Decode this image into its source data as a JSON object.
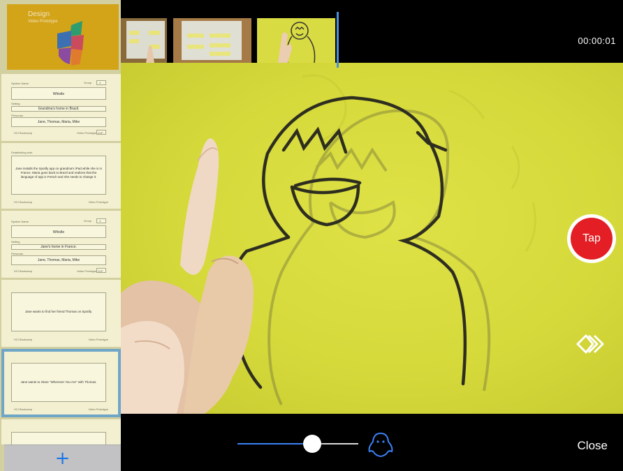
{
  "timecode": "00:00:01",
  "controls": {
    "tap_label": "Tap",
    "close_label": "Close",
    "add_label": "+",
    "opacity_slider_value": 0.62
  },
  "sidebar": {
    "cover": {
      "title": "Design",
      "subtitle": "Video Prototype"
    },
    "cards": [
      {
        "system_name_label": "System Name",
        "group_label": "Group",
        "group_value": "4",
        "system_name": "Whistle",
        "setting_label": "Setting",
        "setting": "Grandma's home in Brazil.",
        "personas_label": "Personas",
        "personas": "Jane, Thomas, Maria, Mike",
        "footer_left": "HCI Bootcamp",
        "footer_right": "Video Prototype",
        "footer_badge": "2VP"
      },
      {
        "header": "Establishing shot",
        "text": "Jane installs the Spotify app on grandma's iPad while she is in France. Maria goes back to Brazil and realizes that the language of app is French and she needs to change it.",
        "footer_left": "HCI Bootcamp",
        "footer_right": "Video Prototype"
      },
      {
        "system_name_label": "System Name",
        "group_label": "Group",
        "group_value": "4",
        "system_name": "Whistle",
        "setting_label": "Setting",
        "setting": "Jane's home in France.",
        "personas_label": "Personas",
        "personas": "Jane, Thomas, Maria, Mike",
        "footer_left": "HCI Bootcamp",
        "footer_right": "Video Prototype",
        "footer_badge": "2VP"
      },
      {
        "text": "Jane wants to find her friend Thomas on Spotify.",
        "footer_left": "HCI Bootcamp",
        "footer_right": "Video Prototype"
      },
      {
        "text": "Jane wants to share \"Wherever You Are\" with Thomas.",
        "footer_left": "HCI Bootcamp",
        "footer_right": "Video Prototype",
        "selected": true
      }
    ]
  },
  "colors": {
    "accent": "#3b82f6",
    "record_red": "#e31e24",
    "paper_yellow": "#d5d93a",
    "cover_gold": "#d3a318",
    "selection": "#6fa6c8"
  },
  "icons": {
    "ghost": "ghost-icon",
    "skip": "double-chevron-right-icon",
    "add": "plus-icon"
  }
}
